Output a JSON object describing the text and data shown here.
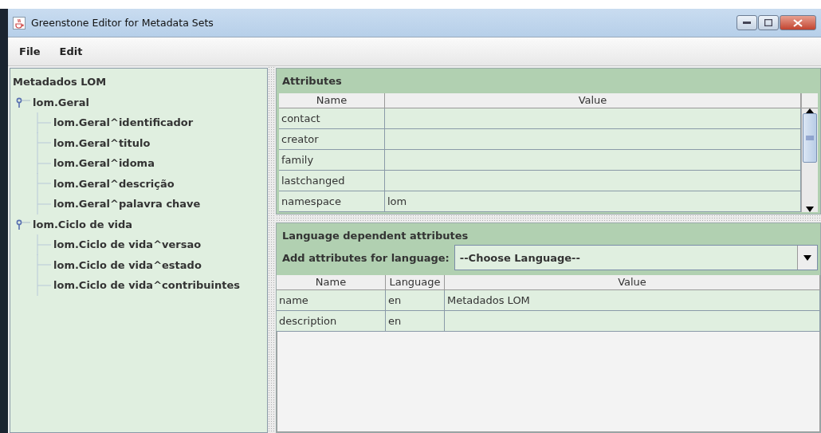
{
  "window": {
    "title": "Greenstone Editor for Metadata Sets"
  },
  "menu": [
    "File",
    "Edit"
  ],
  "tree": {
    "label": "Metadados LOM",
    "children": [
      {
        "label": "lom.Geral",
        "expanded": true,
        "children": [
          {
            "label": "lom.Geral^identificador"
          },
          {
            "label": "lom.Geral^titulo"
          },
          {
            "label": "lom.Geral^idoma"
          },
          {
            "label": "lom.Geral^descrição"
          },
          {
            "label": "lom.Geral^palavra chave"
          }
        ]
      },
      {
        "label": "lom.Ciclo de vida",
        "expanded": true,
        "children": [
          {
            "label": "lom.Ciclo de vida^versao"
          },
          {
            "label": "lom.Ciclo de vida^estado"
          },
          {
            "label": "lom.Ciclo de vida^contribuintes"
          }
        ]
      }
    ]
  },
  "attributes": {
    "title": "Attributes",
    "columns": [
      "Name",
      "Value"
    ],
    "rows": [
      [
        "contact",
        ""
      ],
      [
        "creator",
        ""
      ],
      [
        "family",
        ""
      ],
      [
        "lastchanged",
        ""
      ],
      [
        "namespace",
        "lom"
      ]
    ]
  },
  "language_attributes": {
    "title": "Language dependent attributes",
    "add_label": "Add attributes for language:",
    "language_select": "--Choose Language--",
    "columns": [
      "Name",
      "Language",
      "Value"
    ],
    "rows": [
      [
        "name",
        "en",
        "Metadados LOM"
      ],
      [
        "description",
        "en",
        ""
      ]
    ]
  }
}
